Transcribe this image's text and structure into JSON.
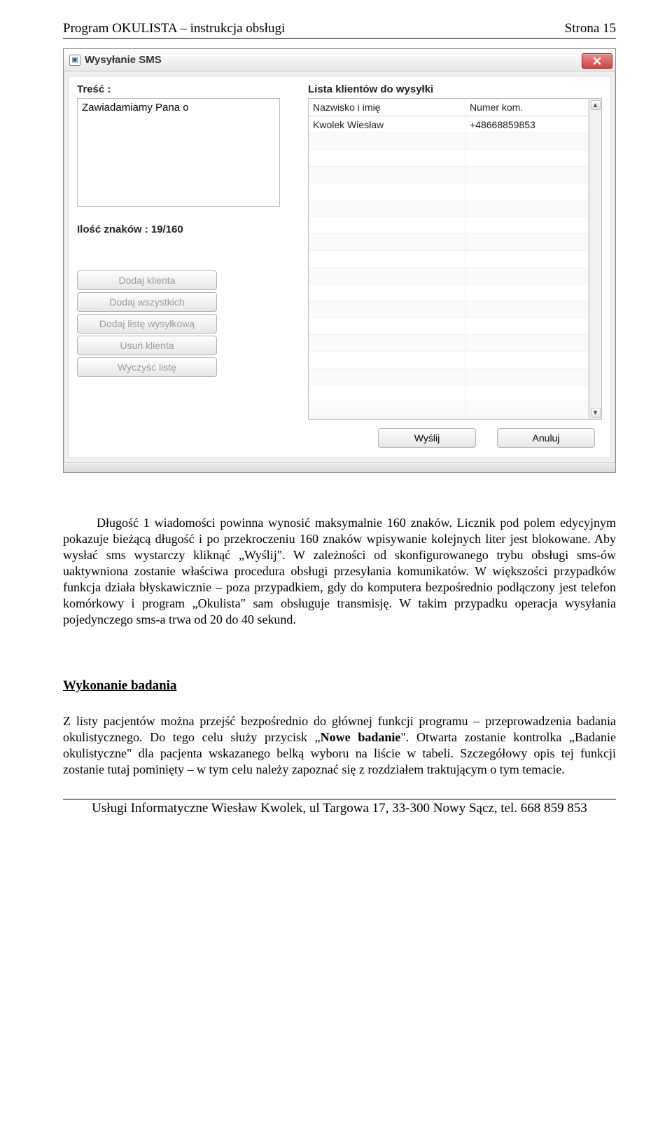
{
  "doc": {
    "header_left": "Program OKULISTA – instrukcja obsługi",
    "header_right": "Strona 15",
    "footer": "Usługi Informatyczne Wiesław Kwolek, ul Targowa 17, 33-300 Nowy Sącz, tel. 668 859 853"
  },
  "dialog": {
    "title": "Wysyłanie SMS",
    "tresc_label": "Treść :",
    "tresc_value": "Zawiadamiamy Pana o",
    "list_label": "Lista klientów do wysyłki",
    "char_count": "Ilość znaków : 19/160",
    "buttons": {
      "dodaj_klienta": "Dodaj klienta",
      "dodaj_wszystkich": "Dodaj wszystkich",
      "dodaj_liste": "Dodaj listę wysyłkową",
      "usun_klienta": "Usuń klienta",
      "wyczysc_liste": "Wyczyść listę",
      "wyslij": "Wyślij",
      "anuluj": "Anuluj"
    },
    "grid": {
      "col_name": "Nazwisko i imię",
      "col_num": "Numer kom.",
      "rows": [
        {
          "name": "Kwolek Wiesław",
          "num": "+48668859853"
        }
      ]
    }
  },
  "body_text": {
    "p1": "Długość 1 wiadomości powinna wynosić maksymalnie 160 znaków. Licznik pod polem edycyjnym pokazuje bieżącą długość i po przekroczeniu 160 znaków wpisywanie kolejnych liter jest blokowane. Aby wysłać sms wystarczy kliknąć „Wyślij\". W zależności od skonfigurowanego trybu obsługi sms-ów uaktywniona zostanie właściwa procedura obsługi przesyłania komunikatów. W większości przypadków funkcja działa błyskawicznie – poza przypadkiem, gdy do komputera bezpośrednio podłączony jest telefon komórkowy i program „Okulista\" sam obsługuje transmisję. W takim przypadku operacja wysyłania pojedynczego sms-a trwa od 20 do 40 sekund.",
    "section_heading": "Wykonanie badania",
    "p2a": "Z listy pacjentów można przejść bezpośrednio do głównej funkcji programu – przeprowadzenia badania okulistycznego. Do tego celu służy przycisk „",
    "p2_bold": "Nowe badanie",
    "p2b": "\". Otwarta zostanie kontrolka „Badanie okulistyczne\" dla pacjenta wskazanego belką wyboru na liście w tabeli. Szczegółowy opis tej funkcji zostanie tutaj pominięty – w tym celu należy zapoznać się z rozdziałem traktującym o tym temacie."
  }
}
